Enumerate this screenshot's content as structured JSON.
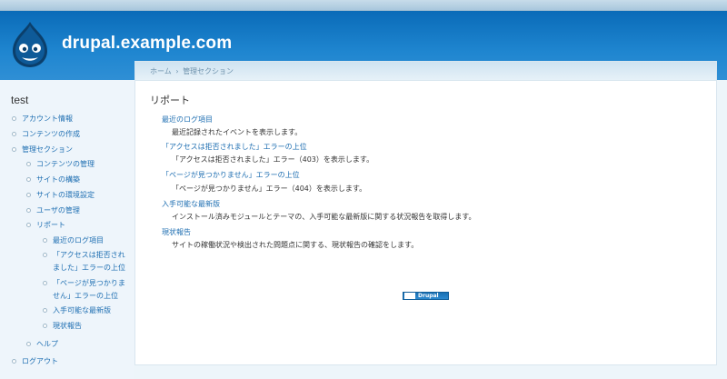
{
  "site": {
    "name": "drupal.example.com"
  },
  "sidebar": {
    "title": "test",
    "items": [
      {
        "label": "アカウント情報"
      },
      {
        "label": "コンテンツの作成"
      },
      {
        "label": "管理セクション"
      },
      {
        "label": "コンテンツの管理"
      },
      {
        "label": "サイトの構築"
      },
      {
        "label": "サイトの環境設定"
      },
      {
        "label": "ユーザの管理"
      },
      {
        "label": "リポート"
      },
      {
        "label": "最近のログ項目"
      },
      {
        "label_line1": "「アクセスは拒否され",
        "label_line2": "ました」エラーの上位"
      },
      {
        "label_line1": "「ページが見つかりま",
        "label_line2": "せん」エラーの上位"
      },
      {
        "label": "入手可能な最新版"
      },
      {
        "label": "現状報告"
      },
      {
        "label": "ヘルプ"
      },
      {
        "label": "ログアウト"
      }
    ]
  },
  "breadcrumb": {
    "home": "ホーム",
    "separator": "›",
    "admin": "管理セクション"
  },
  "main": {
    "title": "リポート",
    "reports": [
      {
        "title": "最近のログ項目",
        "description": "最近記録されたイベントを表示します。"
      },
      {
        "title": "「アクセスは拒否されました」エラーの上位",
        "description": "「アクセスは拒否されました」エラー（403）を表示します。"
      },
      {
        "title": "「ページが見つかりません」エラーの上位",
        "description": "「ページが見つかりません」エラー（404）を表示します。"
      },
      {
        "title": "入手可能な最新版",
        "description": "インストール済みモジュールとテーマの、入手可能な最新版に関する状況報告を取得します。"
      },
      {
        "title": "現状報告",
        "description": "サイトの稼働状況や検出された問題点に関する、現状報告の確認をします。"
      }
    ]
  },
  "footer": {
    "powered_by": "Drupal"
  }
}
